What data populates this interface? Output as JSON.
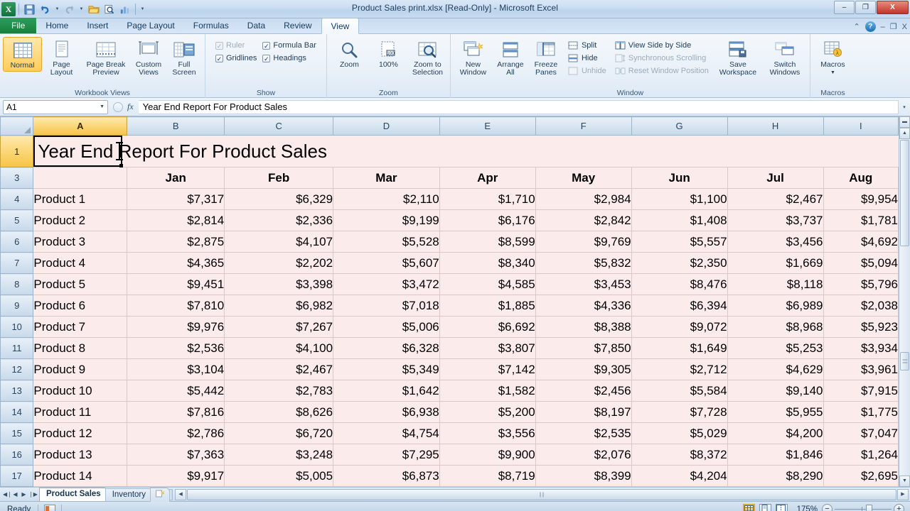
{
  "window": {
    "title": "Product Sales print.xlsx  [Read-Only]  -  Microsoft Excel",
    "minimize": "–",
    "restore": "❐",
    "close": "X"
  },
  "quick_access": {
    "logo": "X",
    "items": [
      {
        "name": "save-icon",
        "glyph": "💾"
      },
      {
        "name": "undo-icon",
        "glyph": "↶"
      },
      {
        "name": "redo-icon",
        "glyph": "↷"
      },
      {
        "name": "open-icon",
        "glyph": "📁"
      },
      {
        "name": "print-preview-icon",
        "glyph": "🔍"
      },
      {
        "name": "chart-icon",
        "glyph": "📊"
      },
      {
        "name": "customize-qat-icon",
        "glyph": "▾"
      }
    ]
  },
  "ribbon": {
    "tabs": [
      {
        "label": "File",
        "active": false,
        "file": true
      },
      {
        "label": "Home",
        "active": false
      },
      {
        "label": "Insert",
        "active": false
      },
      {
        "label": "Page Layout",
        "active": false
      },
      {
        "label": "Formulas",
        "active": false
      },
      {
        "label": "Data",
        "active": false
      },
      {
        "label": "Review",
        "active": false
      },
      {
        "label": "View",
        "active": true
      }
    ],
    "window_controls": {
      "minimize_ribbon": "⌃",
      "help": "?",
      "minimize": "–",
      "restore": "❐",
      "close": "X"
    },
    "groups": [
      {
        "label": "Workbook Views",
        "buttons": [
          {
            "label": "Normal",
            "selected": true
          },
          {
            "label": "Page Layout",
            "selected": false
          },
          {
            "label": "Page Break Preview",
            "selected": false
          },
          {
            "label": "Custom Views",
            "selected": false
          },
          {
            "label": "Full Screen",
            "selected": false
          }
        ]
      },
      {
        "label": "Show",
        "checkboxes": [
          {
            "label": "Ruler",
            "checked": true,
            "disabled": true
          },
          {
            "label": "Formula Bar",
            "checked": true,
            "disabled": false
          },
          {
            "label": "Gridlines",
            "checked": true,
            "disabled": false
          },
          {
            "label": "Headings",
            "checked": true,
            "disabled": false
          }
        ]
      },
      {
        "label": "Zoom",
        "buttons": [
          {
            "label": "Zoom"
          },
          {
            "label": "100%"
          },
          {
            "label": "Zoom to Selection"
          }
        ]
      },
      {
        "label": "Window",
        "buttons": [
          {
            "label": "New Window"
          },
          {
            "label": "Arrange All"
          },
          {
            "label": "Freeze Panes"
          }
        ],
        "small_buttons": [
          {
            "label": "Split",
            "disabled": false
          },
          {
            "label": "Hide",
            "disabled": false
          },
          {
            "label": "Unhide",
            "disabled": true
          },
          {
            "label": "View Side by Side",
            "disabled": false
          },
          {
            "label": "Synchronous Scrolling",
            "disabled": true
          },
          {
            "label": "Reset Window Position",
            "disabled": true
          }
        ],
        "buttons2": [
          {
            "label": "Save Workspace"
          },
          {
            "label": "Switch Windows"
          }
        ]
      },
      {
        "label": "Macros",
        "buttons": [
          {
            "label": "Macros"
          }
        ]
      }
    ]
  },
  "formula_bar": {
    "name_box": "A1",
    "formula": "Year End Report For Product Sales",
    "cancel_icon": "✕",
    "enter_icon": "✓",
    "fx_icon": "fx",
    "expand_icon": "▾"
  },
  "sheet": {
    "columns": [
      "A",
      "B",
      "C",
      "D",
      "E",
      "F",
      "G",
      "H",
      "I"
    ],
    "selected_column": "A",
    "selected_cell": "A1",
    "title_row": {
      "row": "1",
      "text": "Year End Report For Product Sales"
    },
    "header_row": {
      "row": "3",
      "label": "",
      "months": [
        "Jan",
        "Feb",
        "Mar",
        "Apr",
        "May",
        "Jun",
        "Jul",
        "Aug"
      ]
    },
    "rows": [
      {
        "row": "4",
        "product": "Product 1",
        "values": [
          "$7,317",
          "$6,329",
          "$2,110",
          "$1,710",
          "$2,984",
          "$1,100",
          "$2,467",
          "$9,954"
        ]
      },
      {
        "row": "5",
        "product": "Product 2",
        "values": [
          "$2,814",
          "$2,336",
          "$9,199",
          "$6,176",
          "$2,842",
          "$1,408",
          "$3,737",
          "$1,781"
        ]
      },
      {
        "row": "6",
        "product": "Product 3",
        "values": [
          "$2,875",
          "$4,107",
          "$5,528",
          "$8,599",
          "$9,769",
          "$5,557",
          "$3,456",
          "$4,692"
        ]
      },
      {
        "row": "7",
        "product": "Product 4",
        "values": [
          "$4,365",
          "$2,202",
          "$5,607",
          "$8,340",
          "$5,832",
          "$2,350",
          "$1,669",
          "$5,094"
        ]
      },
      {
        "row": "8",
        "product": "Product 5",
        "values": [
          "$9,451",
          "$3,398",
          "$3,472",
          "$4,585",
          "$3,453",
          "$8,476",
          "$8,118",
          "$5,796"
        ]
      },
      {
        "row": "9",
        "product": "Product 6",
        "values": [
          "$7,810",
          "$6,982",
          "$7,018",
          "$1,885",
          "$4,336",
          "$6,394",
          "$6,989",
          "$2,038"
        ]
      },
      {
        "row": "10",
        "product": "Product 7",
        "values": [
          "$9,976",
          "$7,267",
          "$5,006",
          "$6,692",
          "$8,388",
          "$9,072",
          "$8,968",
          "$5,923"
        ]
      },
      {
        "row": "11",
        "product": "Product 8",
        "values": [
          "$2,536",
          "$4,100",
          "$6,328",
          "$3,807",
          "$7,850",
          "$1,649",
          "$5,253",
          "$3,934"
        ]
      },
      {
        "row": "12",
        "product": "Product 9",
        "values": [
          "$3,104",
          "$2,467",
          "$5,349",
          "$7,142",
          "$9,305",
          "$2,712",
          "$4,629",
          "$3,961"
        ]
      },
      {
        "row": "13",
        "product": "Product 10",
        "values": [
          "$5,442",
          "$2,783",
          "$1,642",
          "$1,582",
          "$2,456",
          "$5,584",
          "$9,140",
          "$7,915"
        ]
      },
      {
        "row": "14",
        "product": "Product 11",
        "values": [
          "$7,816",
          "$8,626",
          "$6,938",
          "$5,200",
          "$8,197",
          "$7,728",
          "$5,955",
          "$1,775"
        ]
      },
      {
        "row": "15",
        "product": "Product 12",
        "values": [
          "$2,786",
          "$6,720",
          "$4,754",
          "$3,556",
          "$2,535",
          "$5,029",
          "$4,200",
          "$7,047"
        ]
      },
      {
        "row": "16",
        "product": "Product 13",
        "values": [
          "$7,363",
          "$3,248",
          "$7,295",
          "$9,900",
          "$2,076",
          "$8,372",
          "$1,846",
          "$1,264"
        ]
      },
      {
        "row": "17",
        "product": "Product 14",
        "values": [
          "$9,917",
          "$5,005",
          "$6,873",
          "$8,719",
          "$8,399",
          "$4,204",
          "$8,290",
          "$2,695"
        ]
      }
    ]
  },
  "sheet_tabs": {
    "nav": [
      "◀❘",
      "◀",
      "▶",
      "❘▶"
    ],
    "tabs": [
      {
        "label": "Product Sales",
        "active": true
      },
      {
        "label": "Inventory",
        "active": false
      }
    ],
    "new_sheet_icon": "➕"
  },
  "status_bar": {
    "status": "Ready",
    "view_buttons": [
      {
        "name": "normal-view-button",
        "active": true
      },
      {
        "name": "page-layout-view-button",
        "active": false
      },
      {
        "name": "page-break-preview-button",
        "active": false
      }
    ],
    "zoom_level": "175%",
    "zoom_out": "−",
    "zoom_in": "+"
  }
}
